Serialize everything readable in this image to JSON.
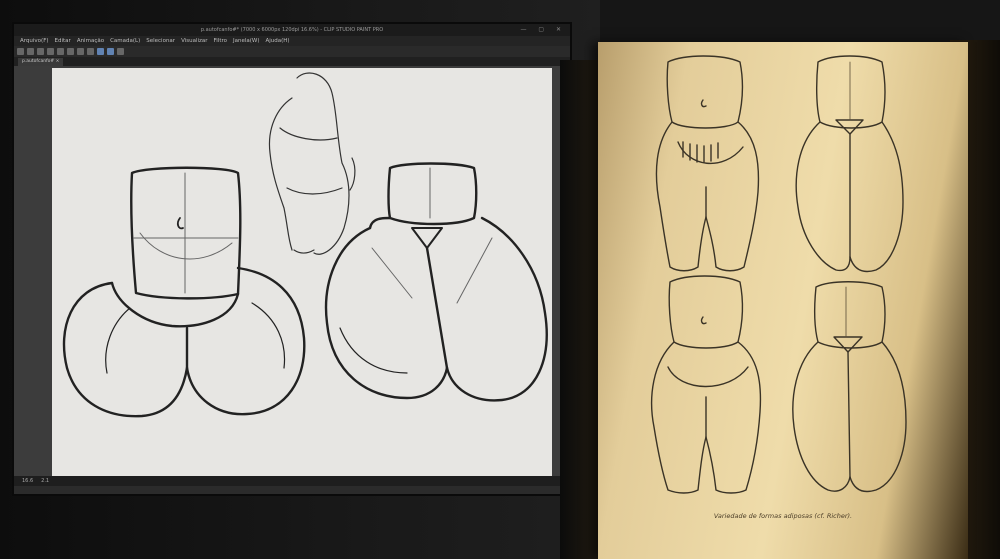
{
  "app": {
    "title": "p.autofcanfo#* (7000 x 6000px 120dpi 16.6%) - CLIP STUDIO PAINT PRO",
    "window_controls": "— ▢ ✕",
    "menu": [
      "Arquivo(F)",
      "Editar",
      "Animação",
      "Camada(L)",
      "Selecionar",
      "Visualizar",
      "Filtro",
      "Janela(W)",
      "Ajuda(H)"
    ],
    "document_tab": "p.autofcanfo# ×",
    "status": {
      "zoom": "16.6",
      "angle": "2.1"
    },
    "toolbar_icons": [
      "new-icon",
      "open-icon",
      "save-icon",
      "undo-icon",
      "redo-icon",
      "transform-icon",
      "fill-icon",
      "select-icon",
      "pen-icon",
      "eraser-icon",
      "ruler-icon"
    ]
  },
  "book": {
    "caption": "Variedade de formas adiposas (cf. Richer)."
  },
  "colors": {
    "canvas": "#e7e6e3",
    "ui_dark": "#2b2b2b",
    "paper": "#efdcaa",
    "ink": "#2a2a2a"
  }
}
